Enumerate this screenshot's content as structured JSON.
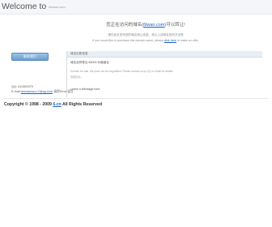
{
  "header": {
    "title": "Welcome to",
    "domain_small": "6ewan.com"
  },
  "notice": {
    "main_prefix": "您正在访问的域名(",
    "domain_link": "6lwan.com",
    "main_suffix": ")可以转让!",
    "sub": "请在此处发布您的域名转让信息，将以上述域名的形式出售",
    "sub2_prefix": "If you would like to purchase this domain name, please ",
    "sub2_link": "click here",
    "sub2_suffix": " to make an offer."
  },
  "left": {
    "button_label": "联系我们",
    "qq": "QQ: 411300379",
    "email_prefix": "E-mail:",
    "email_link": "domainsurv.Y@qq.com",
    "email_extra": "请把Email留言"
  },
  "right": {
    "header_text": "域名出售信息",
    "line1": "域名全称售出 $3000 价格面议",
    "line2": "Domain for sale, the price can be negotiated. Please contact us by QQ or email for details.",
    "line3": "欢迎出价。",
    "message": "Leave a Message here"
  },
  "footer": {
    "prefix": "Copyright © 1998 - 2009 ",
    "link": "6.cn",
    "suffix": " All Rights Reserved"
  }
}
